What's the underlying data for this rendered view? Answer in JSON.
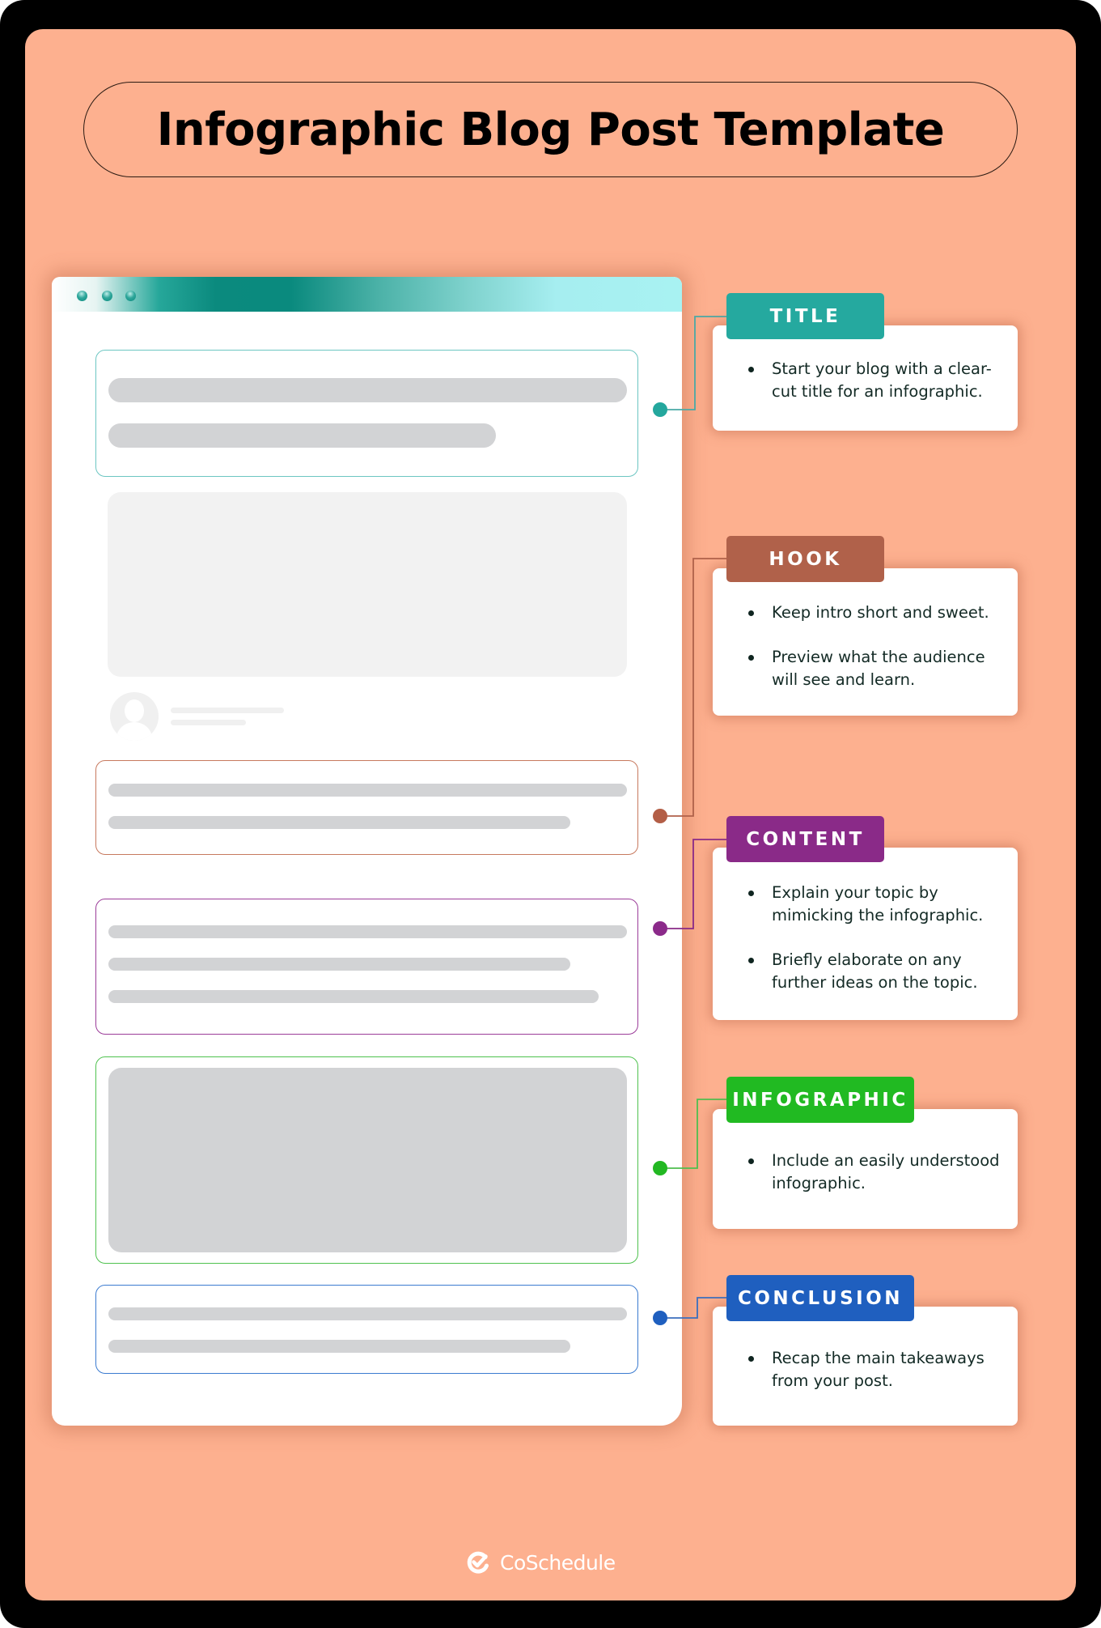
{
  "header": {
    "title": "Infographic Blog Post Template"
  },
  "browser_mockup": {
    "window_dots": [
      "window-dot",
      "window-dot",
      "window-dot"
    ],
    "header_gradient_colors": [
      "#ffffff",
      "#0a8a7e",
      "#a8f2f2"
    ],
    "sections": [
      {
        "id": "title",
        "border_color": "#6cc6c2",
        "dot_color": "#24a79d"
      },
      {
        "id": "hook",
        "border_color": "#c7795e",
        "dot_color": "#b35e46"
      },
      {
        "id": "content",
        "border_color": "#9b3c99",
        "dot_color": "#8b2a8a"
      },
      {
        "id": "infographic",
        "border_color": "#4fc24f",
        "dot_color": "#22b822"
      },
      {
        "id": "conclusion",
        "border_color": "#3b7bd0",
        "dot_color": "#1f5fbf"
      }
    ]
  },
  "callouts": [
    {
      "label": "TITLE",
      "color": "#25a99f",
      "bullets": [
        "Start your blog with a clear-cut title for an infographic."
      ]
    },
    {
      "label": "HOOK",
      "color": "#b0614a",
      "bullets": [
        "Keep intro short and sweet.",
        "Preview what the audience will see and learn."
      ]
    },
    {
      "label": "CONTENT",
      "color": "#8a2a88",
      "bullets": [
        "Explain your topic by mimicking the infographic.",
        "Briefly elaborate on any further ideas on the topic."
      ]
    },
    {
      "label": "INFOGRAPHIC",
      "color": "#21ba22",
      "bullets": [
        "Include an easily understood infographic."
      ]
    },
    {
      "label": "CONCLUSION",
      "color": "#1f5fbf",
      "bullets": [
        "Recap the main takeaways from your post."
      ]
    }
  ],
  "footer": {
    "brand": "CoSchedule",
    "brand_icon": "coschedule-check-icon"
  },
  "colors": {
    "background_frame": "#000000",
    "panel": "#fdb08f",
    "placeholder_bar": "#d2d3d5",
    "placeholder_light": "#f2f2f2",
    "body_text": "#132a25"
  }
}
